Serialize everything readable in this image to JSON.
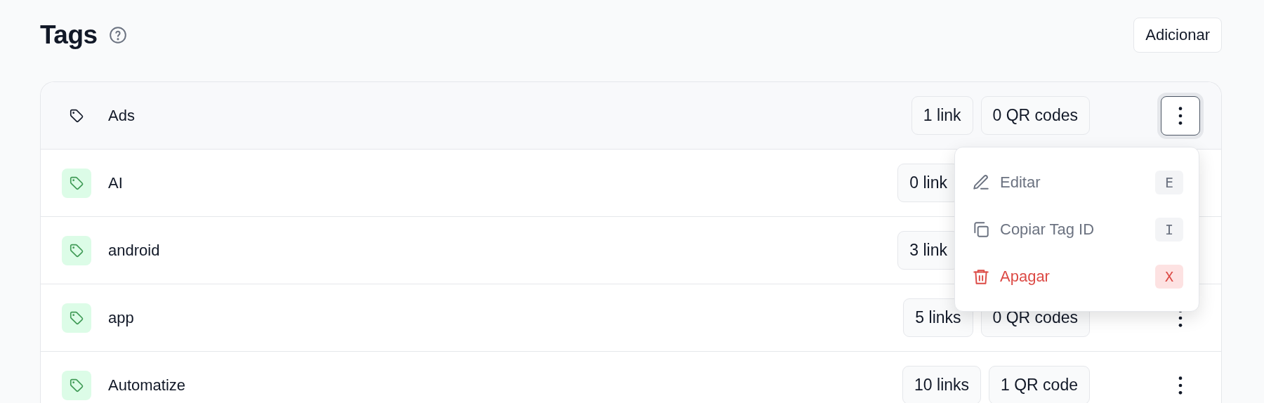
{
  "page": {
    "title": "Tags",
    "add_button": "Adicionar"
  },
  "tags": [
    {
      "name": "Ads",
      "active": true,
      "links": "1 link",
      "qr": "0 QR codes",
      "more_button": true
    },
    {
      "name": "AI",
      "active": false,
      "links": "0 link",
      "more_button": false
    },
    {
      "name": "android",
      "active": false,
      "links": "3 link",
      "more_button": false
    },
    {
      "name": "app",
      "active": false,
      "links": "5 links",
      "qr": "0 QR codes",
      "more_button": true
    },
    {
      "name": "Automatize",
      "active": false,
      "links": "10 links",
      "qr": "1 QR code",
      "more_button": true
    }
  ],
  "menu": {
    "items": [
      {
        "kind": "edit",
        "label": "Editar",
        "shortcut": "E",
        "danger": false
      },
      {
        "kind": "copy",
        "label": "Copiar Tag ID",
        "shortcut": "I",
        "danger": false
      },
      {
        "kind": "delete",
        "label": "Apagar",
        "shortcut": "X",
        "danger": true
      }
    ]
  }
}
